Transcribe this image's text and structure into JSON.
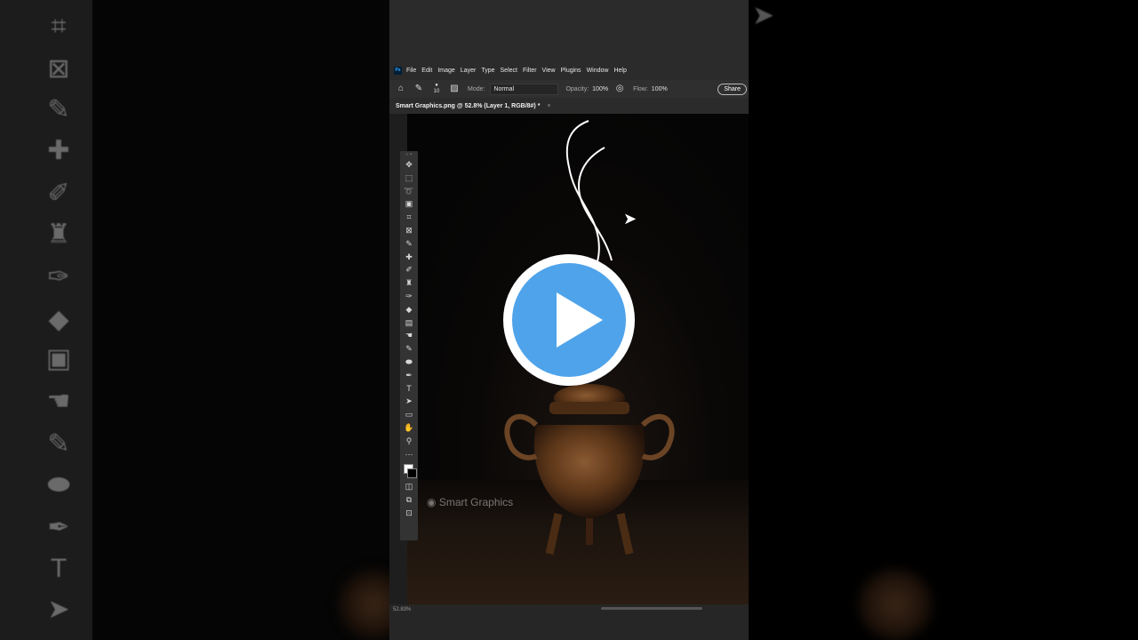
{
  "menubar": {
    "logo": "Ps",
    "items": [
      "File",
      "Edit",
      "Image",
      "Layer",
      "Type",
      "Select",
      "Filter",
      "View",
      "Plugins",
      "Window",
      "Help"
    ]
  },
  "options": {
    "brush_size": "10",
    "mode_label": "Mode:",
    "mode_value": "Normal",
    "opacity_label": "Opacity:",
    "opacity_value": "100%",
    "flow_label": "Flow:",
    "flow_value": "100%",
    "share_label": "Share"
  },
  "document": {
    "tab_title": "Smart Graphics.png @ 52.8% (Layer 1, RGB/8#) *",
    "watermark": "Smart Graphics",
    "status": "52.83%"
  },
  "tools": [
    "move-icon",
    "marquee-icon",
    "lasso-icon",
    "object-select-icon",
    "crop-icon",
    "frame-icon",
    "eyedropper-icon",
    "healing-icon",
    "brush-icon",
    "stamp-icon",
    "history-brush-icon",
    "eraser-icon",
    "gradient-icon",
    "blur-icon",
    "dodge-icon",
    "sponge-icon",
    "pen-icon",
    "type-icon",
    "path-select-icon",
    "rectangle-icon",
    "hand-icon",
    "zoom-icon",
    "more-icon"
  ],
  "colors": {
    "accent": "#4fa3ea",
    "app_bg": "#2b2b2b"
  }
}
